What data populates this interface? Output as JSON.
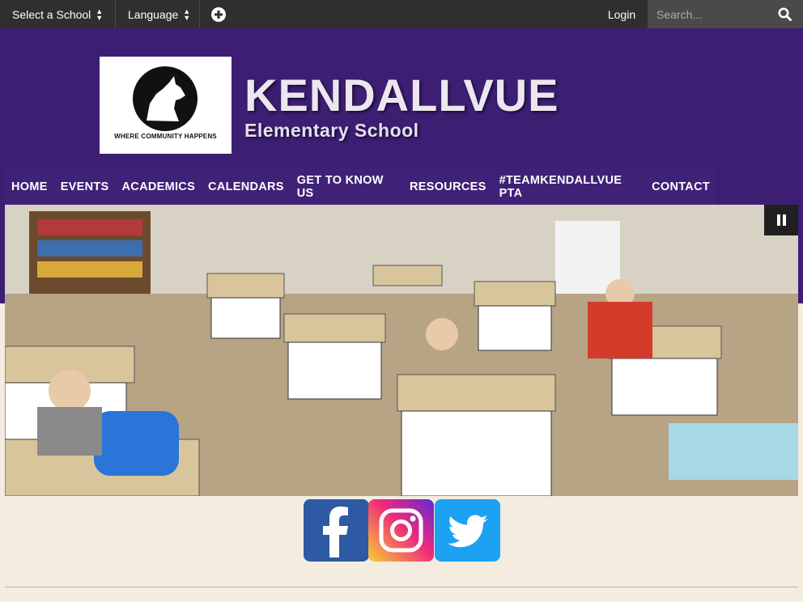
{
  "topbar": {
    "select_school": "Select a School",
    "language": "Language",
    "login": "Login",
    "search_placeholder": "Search..."
  },
  "header": {
    "logo_top": "KENDALLVUE",
    "logo_right": "ELEMENTARY",
    "logo_tagline": "WHERE COMMUNITY HAPPENS",
    "school_name": "KENDALLVUE",
    "school_subtitle": "Elementary School"
  },
  "nav": {
    "items": [
      {
        "label": "HOME"
      },
      {
        "label": "EVENTS"
      },
      {
        "label": "ACADEMICS"
      },
      {
        "label": "CALENDARS"
      },
      {
        "label": "GET TO KNOW US"
      },
      {
        "label": "RESOURCES"
      },
      {
        "label": "#TEAMKENDALLVUE PTA"
      },
      {
        "label": "CONTACT"
      }
    ]
  },
  "hero": {
    "description": "pause-icon"
  },
  "social": {
    "facebook": "facebook-icon",
    "instagram": "instagram-icon",
    "twitter": "twitter-icon"
  },
  "colors": {
    "topbar": "#2f2f2f",
    "header_purple": "#3c1f72",
    "page_bg": "#f3ecdf",
    "facebook": "#2d5aa2",
    "twitter": "#1da1f2"
  }
}
